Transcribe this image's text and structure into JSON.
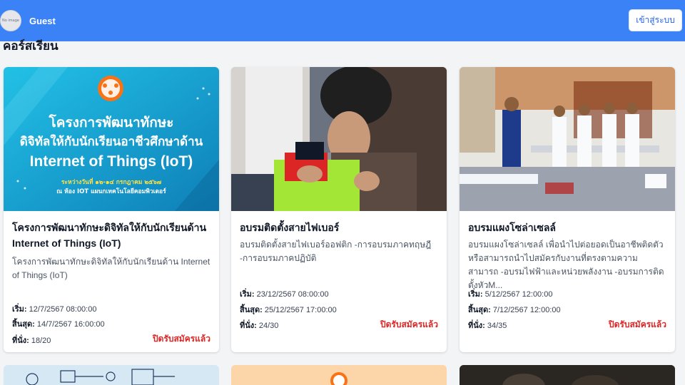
{
  "header": {
    "avatar_text": "No image",
    "user_name": "Guest",
    "login_label": "เข้าสู่ระบบ"
  },
  "section": {
    "title": "คอร์สเรียน"
  },
  "labels": {
    "start": "เริ่ม:",
    "end": "สิ้นสุด:",
    "seats": "ที่นั่ง:"
  },
  "courses": [
    {
      "banner_line1": "โครงการพัฒนาทักษะ",
      "banner_line2": "ดิจิทัลให้กับนักเรียนอาชีวศึกษาด้าน",
      "banner_line3": "Internet of Things (IoT)",
      "banner_line4": "ระหว่างวันที่ ๑๒-๑๔ กรกฎาคม ๒๕๖๗",
      "banner_line5": "ณ ห้อง IOT แผนกเทคโนโลยีคอมพิวเตอร์",
      "title": "โครงการพัฒนาทักษะดิจิทัลให้กับนักเรียนด้าน Internet of Things (IoT)",
      "description": "โครงการพัฒนาทักษะดิจิทัลให้กับนักเรียนด้าน Internet of Things (IoT)",
      "start": "12/7/2567 08:00:00",
      "end": "14/7/2567 16:00:00",
      "seats": "18/20",
      "status": "ปิดรับสมัครแล้ว"
    },
    {
      "title": "อบรมติดตั้งสายไฟเบอร์",
      "description": "อบรมติดตั้งสายไฟเบอร์ออฟติก -การอบรมภาคทฤษฎี -การอบรมภาคปฏิบัติ",
      "start": "23/12/2567 08:00:00",
      "end": "25/12/2567 17:00:00",
      "seats": "24/30",
      "status": "ปิดรับสมัครแล้ว"
    },
    {
      "title": "อบรมแผงโซล่าเซลล์",
      "description": "อบรมแผงโซล่าเซลล์ เพื่อนำไปต่อยอดเป็นอาชีพติดตัว หรือสามารถนำไปสมัครกับงานที่ตรงตามความสามารถ -อบรมไฟฟ้าและหน่วยพลังงาน -อบรมการติดตั้งหัวM...",
      "start": "5/12/2567 12:00:00",
      "end": "7/12/2567 12:00:00",
      "seats": "34/35",
      "status": "ปิดรับสมัครแล้ว"
    }
  ],
  "colors": {
    "header": "#3b82f6",
    "status": "#dc2626",
    "background": "#f3f4f6"
  }
}
